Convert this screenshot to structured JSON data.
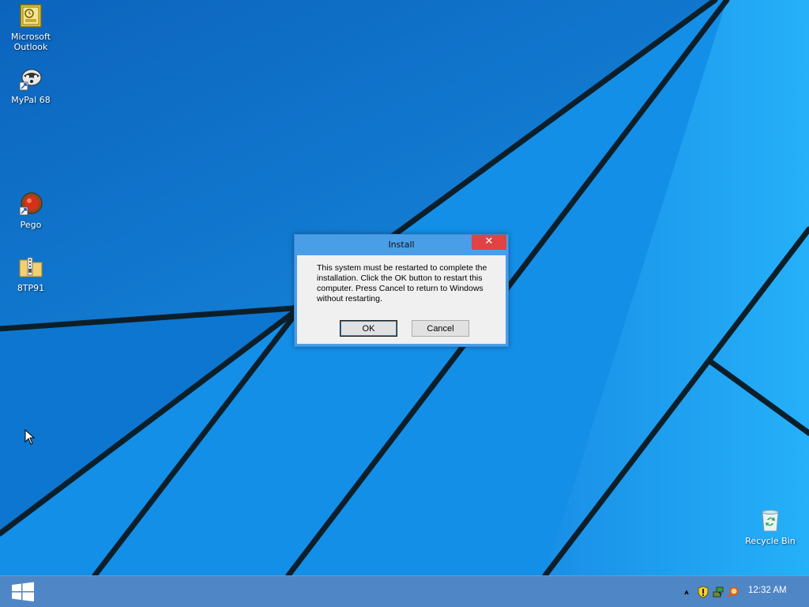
{
  "desktop": {
    "icons": [
      {
        "label": "Microsoft Outlook",
        "icon": "outlook-icon"
      },
      {
        "label": "MyPal 68",
        "icon": "mypal-icon"
      },
      {
        "label": "Pego",
        "icon": "pego-icon"
      },
      {
        "label": "8TP91",
        "icon": "zip-folder-icon"
      },
      {
        "label": "Recycle Bin",
        "icon": "recycle-bin-icon"
      }
    ]
  },
  "dialog": {
    "title": "Install",
    "close_label": "✕",
    "message": "This system must be restarted to complete the installation. Click the OK button to restart this computer. Press Cancel to return to Windows without restarting.",
    "ok_label": "OK",
    "cancel_label": "Cancel"
  },
  "taskbar": {
    "start_icon": "windows-logo-icon",
    "tray_icons": [
      "notification-chevron-icon",
      "security-shield-icon",
      "network-icon",
      "search-icon"
    ],
    "clock": "12:32 AM"
  },
  "colors": {
    "desktop_bg": "#1293ea",
    "taskbar_bg": "#4f86c6",
    "dialog_frame": "#4a9ee8",
    "close_button": "#e04343"
  }
}
